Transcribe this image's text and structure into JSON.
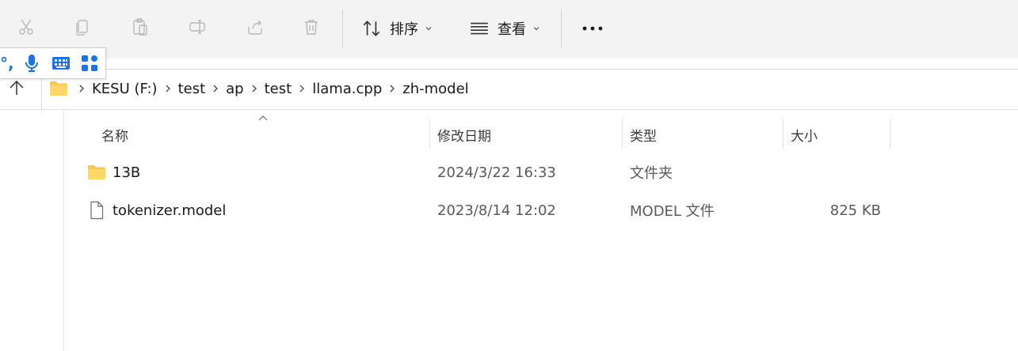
{
  "toolbar": {
    "sort_label": "排序",
    "view_label": "查看",
    "more_label": "..."
  },
  "ime": {
    "punct_label": "°,",
    "icons": [
      "mic-icon",
      "keyboard-icon",
      "apps-icon"
    ]
  },
  "breadcrumb": [
    {
      "label": "KESU (F:)"
    },
    {
      "label": "test"
    },
    {
      "label": "ap"
    },
    {
      "label": "test"
    },
    {
      "label": "llama.cpp"
    },
    {
      "label": "zh-model"
    }
  ],
  "columns": {
    "name": "名称",
    "modified": "修改日期",
    "type": "类型",
    "size": "大小"
  },
  "files": [
    {
      "name": "13B",
      "modified": "2024/3/22 16:33",
      "type": "文件夹",
      "size": "",
      "icon": "folder-icon"
    },
    {
      "name": "tokenizer.model",
      "modified": "2023/8/14 12:02",
      "type": "MODEL 文件",
      "size": "825 KB",
      "icon": "file-icon"
    }
  ],
  "colors": {
    "toolbar_bg": "#f3f3f3",
    "folder_yellow": "#f8c94a",
    "ime_blue": "#1a73e8"
  }
}
